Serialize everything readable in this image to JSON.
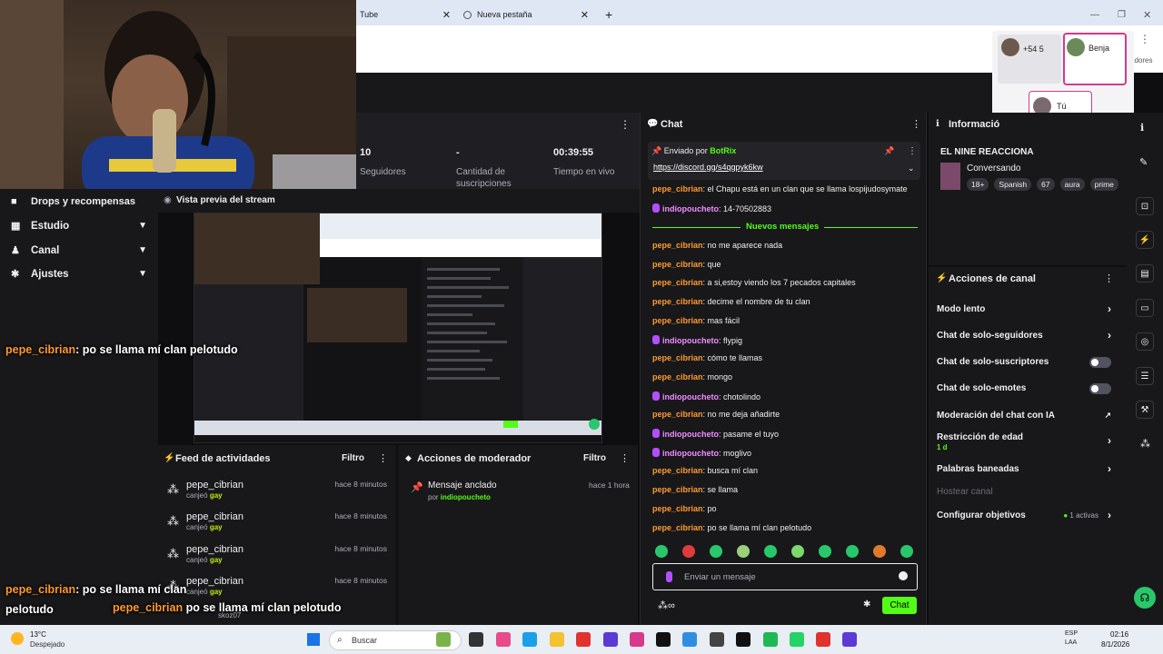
{
  "browser": {
    "tab1_label": "Tube",
    "tab2_label": "Nueva pestaña",
    "window_fragment": "cadores"
  },
  "call": {
    "p1": "+54 5",
    "p2": "Benja",
    "p3": "Tú"
  },
  "stats": {
    "followers_value": "10",
    "followers_label": "Seguidores",
    "subs_value": "-",
    "subs_label": "Cantidad de suscripciones",
    "live_value": "00:39:55",
    "live_label": "Tiempo en vivo"
  },
  "left_nav": {
    "drops": "Drops y recompensas",
    "items": [
      {
        "label": "Estudio"
      },
      {
        "label": "Canal"
      },
      {
        "label": "Ajustes"
      }
    ]
  },
  "preview": {
    "title": "Vista previa del stream"
  },
  "feed": {
    "title": "Feed de actividades",
    "filter": "Filtro",
    "items": [
      {
        "user": "pepe_cibrian",
        "action": "canjeó",
        "reward": "gay",
        "time": "hace 8 minutos"
      },
      {
        "user": "pepe_cibrian",
        "action": "canjeó",
        "reward": "gay",
        "time": "hace 8 minutos"
      },
      {
        "user": "pepe_cibrian",
        "action": "canjeó",
        "reward": "gay",
        "time": "hace 8 minutos"
      },
      {
        "user": "pepe_cibrian",
        "action": "canjeó",
        "reward": "gay",
        "time": "hace 8 minutos"
      }
    ]
  },
  "mod": {
    "title": "Acciones de moderador",
    "filter": "Filtro",
    "pinned_title": "Mensaje anclado",
    "pinned_by": "por",
    "pinned_user": "indiopoucheto",
    "pinned_time": "hace 1 hora"
  },
  "chat": {
    "title": "Chat",
    "pinned_sender_prefix": "Enviado por",
    "pinned_sender": "BotRix",
    "pinned_link": "https://discord.gg/s4qgpyk6kw",
    "new_messages": "Nuevos mensajes",
    "input_placeholder": "Enviar un mensaje",
    "send_label": "Chat",
    "messages_top": [
      {
        "user": "pepe_cibrian",
        "text": ": el Chapu está en un clan que se llama lospijudosymate",
        "mic": false
      },
      {
        "user": "indiopoucheto",
        "text": ": 14-70502883",
        "mic": true
      }
    ],
    "messages": [
      {
        "user": "pepe_cibrian",
        "text": ": no me aparece nada",
        "mic": false
      },
      {
        "user": "pepe_cibrian",
        "text": ": que",
        "mic": false
      },
      {
        "user": "pepe_cibrian",
        "text": ": a si,estoy viendo los 7 pecados capitales",
        "mic": false
      },
      {
        "user": "pepe_cibrian",
        "text": ": decime el nombre de tu clan",
        "mic": false
      },
      {
        "user": "pepe_cibrian",
        "text": ": mas fácil",
        "mic": false
      },
      {
        "user": "indiopoucheto",
        "text": ": flypig",
        "mic": true
      },
      {
        "user": "pepe_cibrian",
        "text": ": cómo te llamas",
        "mic": false
      },
      {
        "user": "pepe_cibrian",
        "text": ": mongo",
        "mic": false
      },
      {
        "user": "indiopoucheto",
        "text": ": chotolindo",
        "mic": true
      },
      {
        "user": "pepe_cibrian",
        "text": ": no me deja añadirte",
        "mic": false
      },
      {
        "user": "indiopoucheto",
        "text": ": pasame el tuyo",
        "mic": true
      },
      {
        "user": "indiopoucheto",
        "text": ": moglivo",
        "mic": true
      },
      {
        "user": "pepe_cibrian",
        "text": ": busca mí clan",
        "mic": false
      },
      {
        "user": "pepe_cibrian",
        "text": ": se llama",
        "mic": false
      },
      {
        "user": "pepe_cibrian",
        "text": ": po",
        "mic": false
      },
      {
        "user": "pepe_cibrian",
        "text": ": po se llama mí clan pelotudo",
        "mic": false
      }
    ]
  },
  "info": {
    "title": "Informació",
    "channel": "EL NINE REACCIONA",
    "category": "Conversando",
    "tags": [
      "18+",
      "Spanish",
      "67",
      "aura",
      "prime"
    ]
  },
  "actions": {
    "title": "Acciones de canal",
    "items": [
      {
        "label": "Modo lento"
      },
      {
        "label": "Chat de solo-seguidores"
      },
      {
        "label": "Chat de solo-suscriptores"
      },
      {
        "label": "Chat de solo-emotes"
      },
      {
        "label": "Moderación del chat con IA"
      },
      {
        "label": "Restricción de edad",
        "sub": "1 d"
      },
      {
        "label": "Palabras baneadas"
      },
      {
        "label": "Hostear canal"
      },
      {
        "label": "Configurar objetivos",
        "badge": "1 activas"
      }
    ]
  },
  "overlay": {
    "l1_user": "pepe_cibrian",
    "l1_text": ": po se llama mí clan pelotudo",
    "l2_user": "pepe_cibrian",
    "l2_text": ": po se llama mí clan",
    "l2b": "pelotudo",
    "l3_user": "pepe_cibrian",
    "l3_text": " po se llama mí clan pelotudo",
    "under": "skoz07"
  },
  "taskbar": {
    "temp": "13°C",
    "weather": "Despejado",
    "search": "Buscar",
    "lang1": "ESP",
    "lang2": "LAA",
    "time": "02:16",
    "date": "8/1/2026"
  },
  "colors": {
    "accent": "#53fc18",
    "username": "#ff9a2e",
    "mod": "#f08cff"
  }
}
